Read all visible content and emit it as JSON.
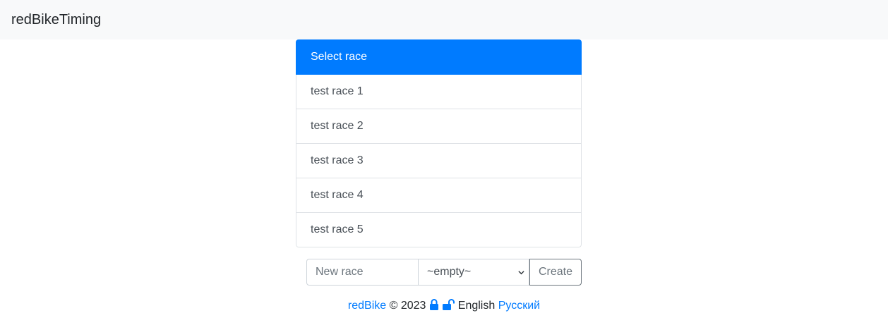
{
  "navbar": {
    "brand": "redBikeTiming"
  },
  "race_list": {
    "header": "Select race",
    "items": [
      {
        "label": "test race 1"
      },
      {
        "label": "test race 2"
      },
      {
        "label": "test race 3"
      },
      {
        "label": "test race 4"
      },
      {
        "label": "test race 5"
      }
    ]
  },
  "create_form": {
    "input_placeholder": "New race",
    "input_value": "",
    "select_value": "~empty~",
    "create_label": "Create"
  },
  "footer": {
    "brand_link": "redBike",
    "copyright": "© 2023",
    "lock_icon": "lock-icon",
    "unlock_icon": "unlock-icon",
    "lang_current": "English",
    "lang_other": "Русский"
  },
  "colors": {
    "primary": "#007bff",
    "navbar_bg": "#f8f9fa",
    "text": "#212529",
    "muted": "#6c757d"
  }
}
